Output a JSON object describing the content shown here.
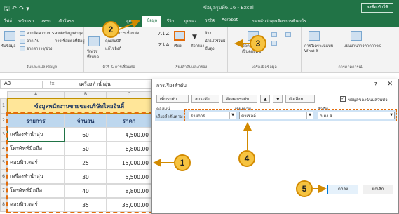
{
  "window": {
    "quick_access": "🖫 ↶ ↷ ▾",
    "title": "ข้อมูลรูปที่6.16 - Excel",
    "signin": "ลงชื่อเข้าใช้"
  },
  "tabs": [
    "ไฟล์",
    "หน้าแรก",
    "แทรก",
    "เค้าโครง",
    "สูตร",
    "ข้อมูล",
    "รีวิว",
    "มุมมอง",
    "วิธีใช้",
    "Acrobat",
    "บอกฉันว่าคุณต้องการทำอะไร"
  ],
  "ribbon": {
    "g1_items": [
      "รับข้อมูล",
      "จากข้อความ/CSV",
      "จากเว็บ",
      "จากตาราง/ช่วง",
      "แหล่งข้อมูลล่าสุด",
      "การเชื่อมต่อที่มีอยู่"
    ],
    "g1_label": "รับและแปลงข้อมูล",
    "g2_items": [
      "รีเฟรช",
      "ทั้งหมด",
      "คิวรีและการเชื่อมต่อ",
      "คุณสมบัติ",
      "แก้ไขลิงก์"
    ],
    "g2_label": "คิวรี & การเชื่อมต่อ",
    "g3_items": [
      "เรียง",
      "ตัวกรอง",
      "ล้าง",
      "นำไปใช้ใหม่",
      "ขั้นสูง"
    ],
    "g3_label": "เรียงลำดับและกรอง",
    "g4_items": [
      "ข้อความ",
      "เป็นคอลัมน์"
    ],
    "g4_label": "เครื่องมือข้อมูล",
    "g5_items": [
      "การวิเคราะห์แบบ",
      "What-If",
      "แผ่นงานการคาดการณ์"
    ],
    "g5_label": "การคาดการณ์"
  },
  "formula_bar": {
    "name": "A3",
    "fx": "fx",
    "value": "เครื่องทำน้ำอุ่น"
  },
  "sheet": {
    "cols": [
      "A",
      "B",
      "C"
    ],
    "rows": [
      "1",
      "2",
      "3",
      "4",
      "5",
      "6",
      "7",
      "8"
    ],
    "title": "ข้อมูลพนักงานขายของบริษัทไทยอินดี้",
    "headers": [
      "รายการ",
      "จำนวน",
      "ราคา"
    ],
    "data": [
      [
        "เครื่องทำน้ำอุ่น",
        "60",
        "4,500.00"
      ],
      [
        "โทรศัพท์มือถือ",
        "50",
        "6,800.00"
      ],
      [
        "คอมพิวเตอร์",
        "25",
        "15,000.00"
      ],
      [
        "เครื่องทำน้ำอุ่น",
        "30",
        "5,500.00"
      ],
      [
        "โทรศัพท์มือถือ",
        "40",
        "8,800.00"
      ],
      [
        "คอมพิวเตอร์",
        "35",
        "35,000.00"
      ]
    ]
  },
  "dialog": {
    "title": "การเรียงลำดับ",
    "help": "?",
    "close": "✕",
    "buttons": [
      "เพิ่มระดับ",
      "ลบระดับ",
      "คัดลอกระดับ",
      "▲",
      "▼",
      "ตัวเลือก..."
    ],
    "has_headers_label": "ข้อมูลของฉันมีส่วนหัว",
    "col_label": "คอลัมน์",
    "sort_on_label": "เรียงตาม",
    "order_label": "ลำดับ",
    "row_label": "เรียงลำดับตาม",
    "col_value": "รายการ",
    "sort_on_value": "ค่าเซลล์",
    "order_value": "ก ถึง ฮ",
    "ok": "ตกลง",
    "cancel": "ยกเลิก"
  },
  "callouts": [
    "1",
    "2",
    "3",
    "4",
    "5"
  ],
  "colors": {
    "excel_green": "#217346",
    "callout_fill": "#f6c340",
    "callout_border": "#d28a00",
    "highlight_dash": "#e36c0a"
  }
}
